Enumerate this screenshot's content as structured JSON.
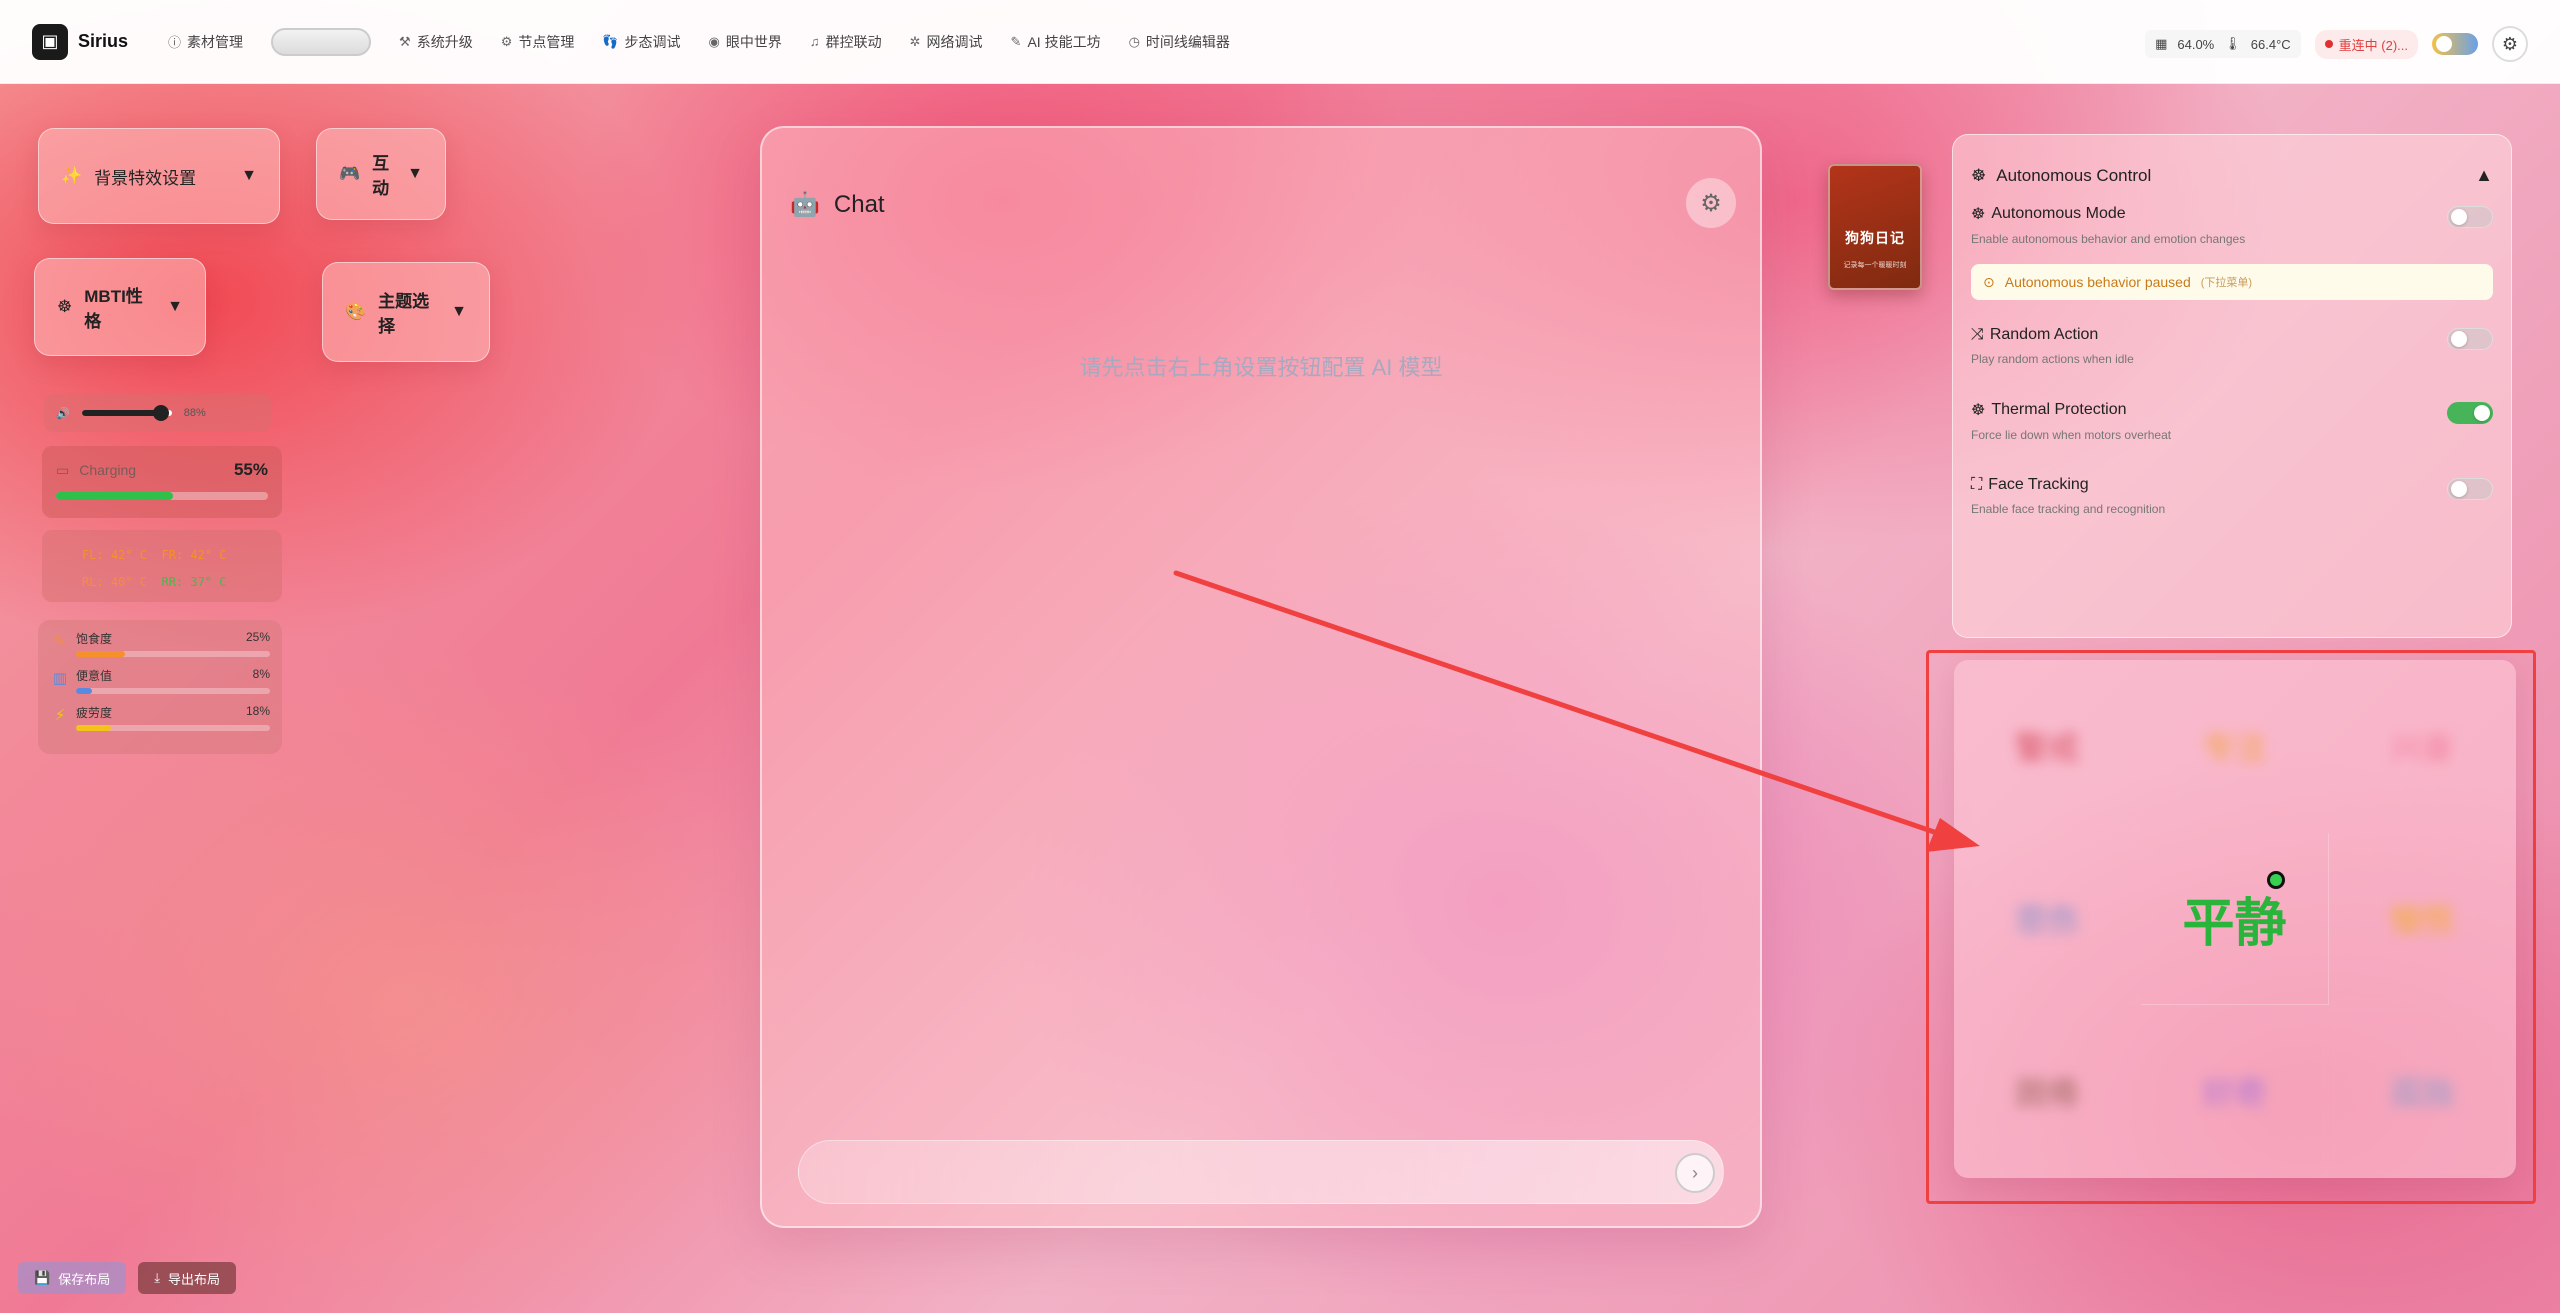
{
  "app": {
    "name": "Sirius",
    "logo_icon": "robot-icon"
  },
  "nav": [
    {
      "label": "素材管理",
      "icon": "question-circle-icon"
    },
    {
      "label": "系统升级",
      "icon": "wrench-icon"
    },
    {
      "label": "节点管理",
      "icon": "gear-icon"
    },
    {
      "label": "步态调试",
      "icon": "footprint-icon"
    },
    {
      "label": "眼中世界",
      "icon": "eye-icon"
    },
    {
      "label": "群控联动",
      "icon": "music-note-icon"
    },
    {
      "label": "网络调试",
      "icon": "bug-icon"
    },
    {
      "label": "AI 技能工坊",
      "icon": "magic-wand-icon"
    },
    {
      "label": "时间线编辑器",
      "icon": "clock-icon"
    }
  ],
  "status": {
    "cpu": "64.0%",
    "temp": "66.4°C",
    "alert": "重连中 (2)..."
  },
  "dropdowns": {
    "bg_effects": "背景特效设置",
    "interact": "互动",
    "mbti": "MBTI性格",
    "theme": "主题选择"
  },
  "volume": {
    "value": "88%",
    "level": 0.88
  },
  "battery": {
    "label": "Charging",
    "percent": "55%",
    "level": 0.55
  },
  "temps": {
    "fl": "FL: 42° C",
    "fr": "FR: 42° C",
    "rl": "RL: 40° C",
    "rr": "RR: 37° C"
  },
  "needs": [
    {
      "label": "饱食度",
      "value": "25%",
      "level": 0.25,
      "color": "#f5902a"
    },
    {
      "label": "便意值",
      "value": "8%",
      "level": 0.08,
      "color": "#5a8ae0"
    },
    {
      "label": "疲劳度",
      "value": "18%",
      "level": 0.18,
      "color": "#f2c41a"
    }
  ],
  "buttons": {
    "save_layout": "保存布局",
    "export_layout": "导出布局"
  },
  "chat": {
    "title": "Chat",
    "hint": "请先点击右上角设置按钮配置 AI 模型",
    "input_placeholder": ""
  },
  "diary": {
    "title": "狗狗日记",
    "subtitle": "记录每一个暖暖时刻"
  },
  "autonomous": {
    "title": "Autonomous Control",
    "mode": {
      "title": "Autonomous Mode",
      "desc": "Enable autonomous behavior and emotion changes",
      "on": false
    },
    "paused": {
      "text": "Autonomous behavior paused",
      "sub": "(下拉菜单)"
    },
    "random": {
      "title": "Random Action",
      "desc": "Play random actions when idle",
      "on": false
    },
    "thermal": {
      "title": "Thermal Protection",
      "desc": "Force lie down when motors overheat",
      "on": true
    },
    "face": {
      "title": "Face Tracking",
      "desc": "Enable face tracking and recognition",
      "on": false
    }
  },
  "emotions": [
    {
      "label": "警戒",
      "color": "#d04050",
      "active": false
    },
    {
      "label": "专注",
      "color": "#f0a020",
      "active": false
    },
    {
      "label": "兴奋",
      "color": "#f07090",
      "active": false
    },
    {
      "label": "悲伤",
      "color": "#6a8ad0",
      "active": false
    },
    {
      "label": "平静",
      "color": "#2ab43c",
      "active": true
    },
    {
      "label": "愉悦",
      "color": "#f0b010",
      "active": false
    },
    {
      "label": "困倦",
      "color": "#8a5a4a",
      "active": false
    },
    {
      "label": "好奇",
      "color": "#9a6ae0",
      "active": false
    },
    {
      "label": "孤独",
      "color": "#7a9ad0",
      "active": false
    }
  ],
  "colors": {
    "accent_red": "#f04040",
    "active_green": "#2ab43c"
  }
}
